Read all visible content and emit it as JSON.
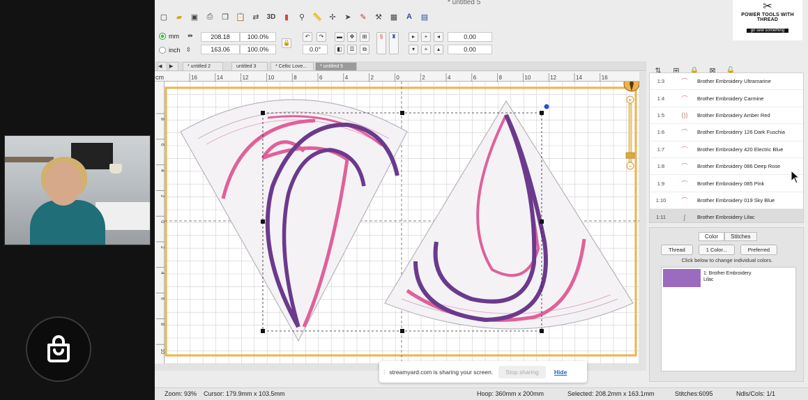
{
  "window": {
    "title": "* untitled 5"
  },
  "brand": {
    "line1": "POWER TOOLS WITH THREAD",
    "line2": "go sew something"
  },
  "units": {
    "mm_label": "mm",
    "inch_label": "inch",
    "width": "208.18",
    "height": "163.06",
    "width_pct": "100.0%",
    "height_pct": "100.0%",
    "rotation": "0.0°",
    "offset_x": "0.00",
    "offset_y": "0.00"
  },
  "tabs": [
    {
      "label": "* untitled 2"
    },
    {
      "label": "untitled 3"
    },
    {
      "label": "* Celtic Love..."
    },
    {
      "label": "* untitled 5"
    }
  ],
  "rulers": {
    "top": [
      "16",
      "14",
      "12",
      "10",
      "8",
      "6",
      "4",
      "2",
      "0",
      "2",
      "4",
      "6",
      "8",
      "10",
      "12",
      "14",
      "16"
    ],
    "left": [
      "8",
      "6",
      "4",
      "2",
      "0",
      "2",
      "4",
      "6",
      "8",
      "10"
    ],
    "unit_label": "cm"
  },
  "threads": [
    {
      "index": "1:3",
      "name": "Brother Embroidery Ultramarine"
    },
    {
      "index": "1:4",
      "name": "Brother Embroidery Carmine"
    },
    {
      "index": "1:5",
      "name": "Brother Embroidery Amber Red"
    },
    {
      "index": "1:6",
      "name": "Brother Embroidery 126 Dark Fuschia"
    },
    {
      "index": "1:7",
      "name": "Brother Embroidery 420 Electric Blue"
    },
    {
      "index": "1:8",
      "name": "Brother Embroidery 086 Deep Rose"
    },
    {
      "index": "1:9",
      "name": "Brother Embroidery 085 Pink"
    },
    {
      "index": "1:10",
      "name": "Brother Embroidery 019 Sky Blue"
    },
    {
      "index": "1:11",
      "name": "Brother Embroidery Lilac"
    }
  ],
  "color_panel": {
    "tab_color": "Color",
    "tab_stitches": "Stitches",
    "btn_thread": "Thread",
    "btn_color": "1 Color...",
    "btn_preferred": "Preferred",
    "hint": "Click below to change individual colors.",
    "selected_line1": "1: Brother Embroidery",
    "selected_line2": "Lilac",
    "selected_color": "#9b6bbf"
  },
  "share_bar": {
    "message": "streamyard.com is sharing your screen.",
    "stop": "Stop sharing",
    "hide": "Hide"
  },
  "status": {
    "zoom": "Zoom: 93%",
    "cursor": "Cursor: 179.9mm x 103.5mm",
    "hoop": "Hoop: 360mm x 200mm",
    "selected": "Selected: 208.2mm x 163.1mm",
    "stitches": "Stitches:6095",
    "ndls": "Ndls/Cols: 1/1"
  },
  "colors": {
    "pink": "#e0609a",
    "purple": "#6b3a8c",
    "hoop_orange": "#f0b24a"
  }
}
